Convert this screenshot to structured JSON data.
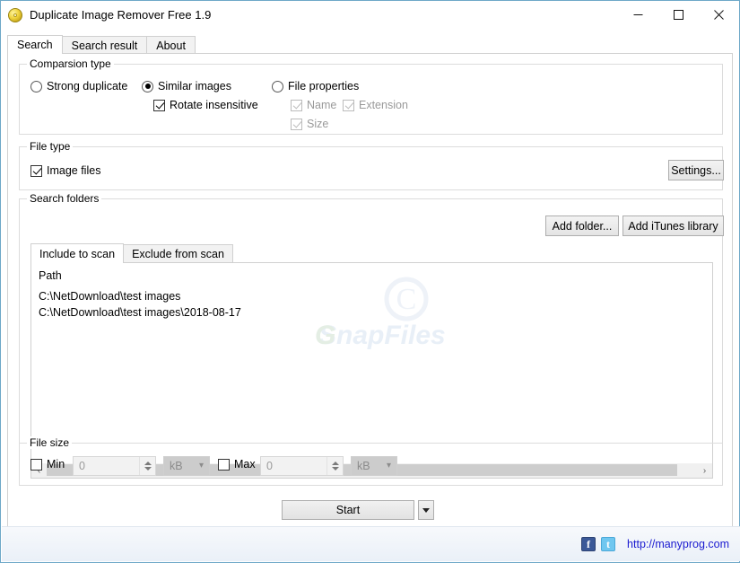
{
  "window": {
    "title": "Duplicate Image Remover Free 1.9",
    "icon": "disc-icon",
    "controls": {
      "minimize": "minimize-icon",
      "maximize": "maximize-icon",
      "close": "close-icon"
    }
  },
  "tabs": [
    {
      "label": "Search",
      "selected": true
    },
    {
      "label": "Search result",
      "selected": false
    },
    {
      "label": "About",
      "selected": false
    }
  ],
  "comparison": {
    "title": "Comparsion type",
    "options": [
      {
        "label": "Strong duplicate",
        "checked": false
      },
      {
        "label": "Similar images",
        "checked": true
      },
      {
        "label": "File properties",
        "checked": false
      }
    ],
    "rotate_insensitive": {
      "label": "Rotate insensitive",
      "checked": true,
      "disabled": false
    },
    "properties": [
      {
        "label": "Name",
        "checked": true,
        "disabled": true
      },
      {
        "label": "Extension",
        "checked": true,
        "disabled": true
      },
      {
        "label": "Size",
        "checked": true,
        "disabled": true
      }
    ]
  },
  "file_type": {
    "title": "File type",
    "image_files": {
      "label": "Image files",
      "checked": true
    },
    "settings_button": "Settings..."
  },
  "search_folders": {
    "title": "Search folders",
    "add_folder_button": "Add folder...",
    "add_itunes_button": "Add iTunes library",
    "subtabs": [
      {
        "label": "Include to scan",
        "selected": true
      },
      {
        "label": "Exclude from scan",
        "selected": false
      }
    ],
    "column_header": "Path",
    "rows": [
      "C:\\NetDownload\\test images",
      "C:\\NetDownload\\test images\\2018-08-17"
    ],
    "watermark": "SnapFiles",
    "scroll_left": "‹",
    "scroll_right": "›"
  },
  "file_size": {
    "title": "File size",
    "min": {
      "label": "Min",
      "checked": false,
      "value": "0",
      "unit": "kB"
    },
    "max": {
      "label": "Max",
      "checked": false,
      "value": "0",
      "unit": "kB"
    }
  },
  "actions": {
    "start_label": "Start",
    "start_dropdown": "chevron-down-icon"
  },
  "statusbar": {
    "facebook": "f",
    "twitter": "t",
    "url": "http://manyprog.com"
  },
  "colors": {
    "window_border": "#6ea8c8",
    "link": "#1a1ad0",
    "facebook": "#3b5998",
    "twitter": "#6fc7f0"
  }
}
